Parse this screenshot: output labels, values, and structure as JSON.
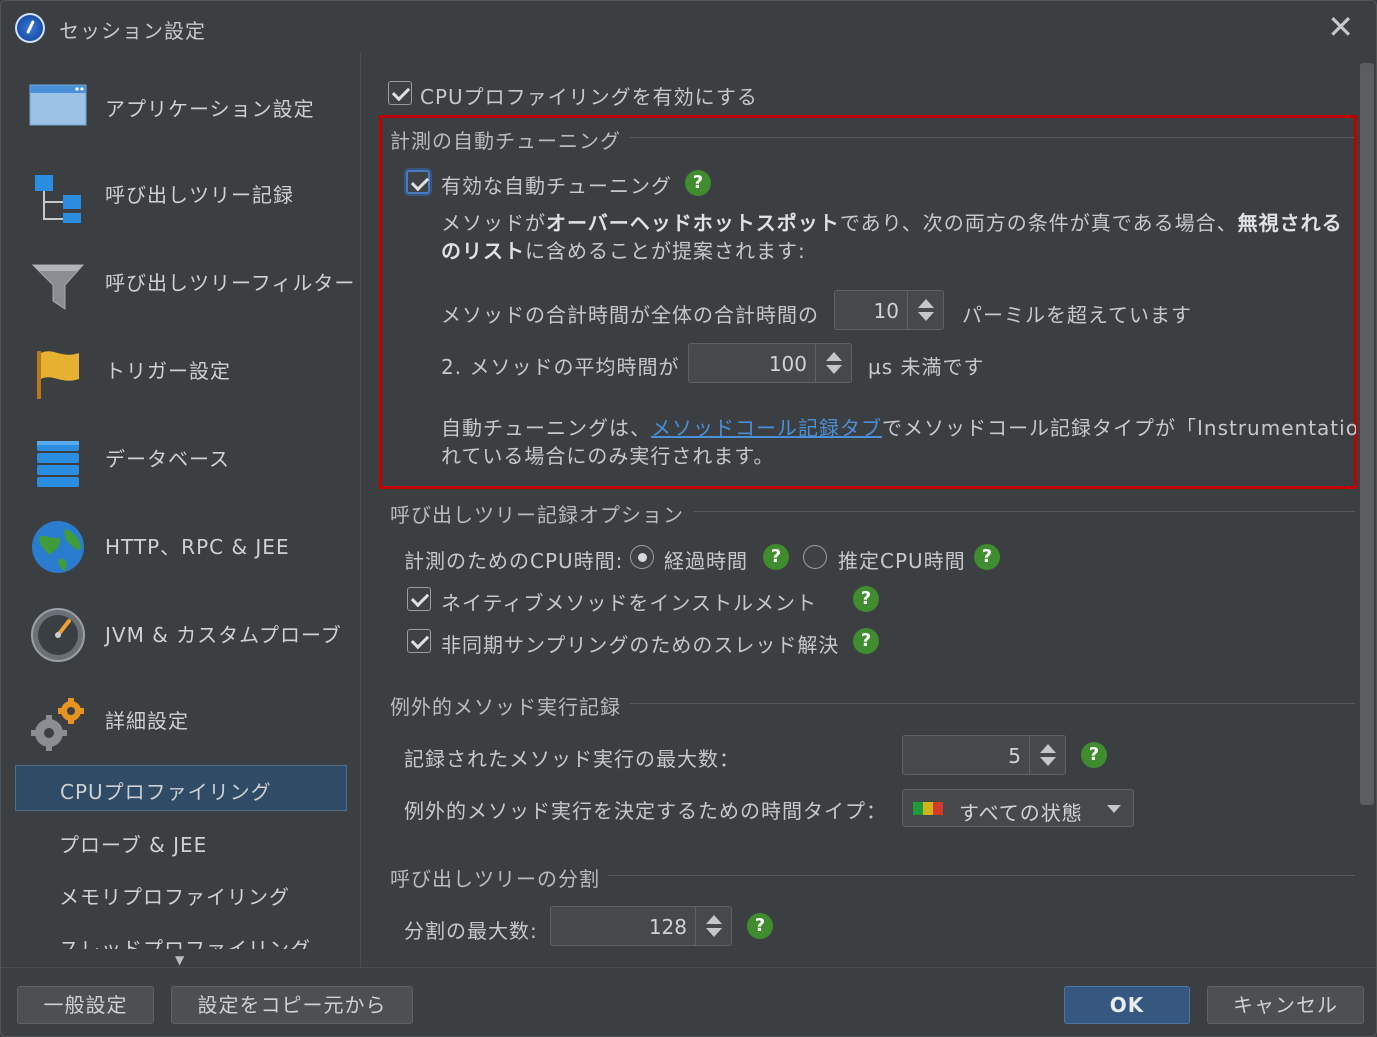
{
  "window": {
    "title": "セッション設定",
    "close_glyph": "✕"
  },
  "sidebar": {
    "items": [
      {
        "label": "アプリケーション設定",
        "icon": "application-window-icon"
      },
      {
        "label": "呼び出しツリー記録",
        "icon": "call-tree-icon"
      },
      {
        "label": "呼び出しツリーフィルター",
        "icon": "funnel-icon"
      },
      {
        "label": "トリガー設定",
        "icon": "flag-icon"
      },
      {
        "label": "データベース",
        "icon": "database-icon"
      },
      {
        "label": "HTTP、RPC & JEE",
        "icon": "globe-icon"
      },
      {
        "label": "JVM & カスタムプローブ",
        "icon": "gauge-icon"
      },
      {
        "label": "詳細設定",
        "icon": "gears-icon"
      }
    ],
    "subitems": [
      {
        "label": "CPUプロファイリング",
        "selected": true
      },
      {
        "label": "プローブ & JEE"
      },
      {
        "label": "メモリプロファイリング"
      },
      {
        "label": "スレッドプロファイリング"
      }
    ]
  },
  "main": {
    "enable_cpu": {
      "label": "CPUプロファイリングを有効にする",
      "checked": true
    },
    "autotune": {
      "section_title": "計測の自動チューニング",
      "enable_label": "有効な自動チューニング",
      "desc_a": "メソッドが",
      "desc_b": "オーバーヘッドホットスポット",
      "desc_c": "であり、次の両方の条件が真である場合、",
      "desc_d": "無視される",
      "desc_e": "のリスト",
      "desc_f": "に含めることが提案されます:",
      "cond1_label": "メソッドの合計時間が全体の合計時間の",
      "cond1_value": "10",
      "cond1_suffix": "パーミルを超えています",
      "cond2_label": "2. メソッドの平均時間が",
      "cond2_value": "100",
      "cond2_suffix": "µs 未満です",
      "note_a": "自動チューニングは、",
      "note_link": "メソッドコール記録タブ",
      "note_b": "でメソッドコール記録タイプが「Instrumentation」",
      "note_c": "れている場合にのみ実行されます。"
    },
    "calltree": {
      "section_title": "呼び出しツリー記録オプション",
      "cpu_time_label": "計測のためのCPU時間:",
      "radio_elapsed": "経過時間",
      "radio_estimated": "推定CPU時間",
      "native_label": "ネイティブメソッドをインストルメント",
      "async_label": "非同期サンプリングのためのスレッド解決"
    },
    "exceptional": {
      "section_title": "例外的メソッド実行記録",
      "max_label": "記録されたメソッド実行の最大数：",
      "max_value": "5",
      "timetype_label": "例外的メソッド実行を決定するための時間タイプ：",
      "timetype_value": "すべての状態",
      "swatch_colors": [
        "#1f9a3a",
        "#d4b21c",
        "#d23b2b"
      ]
    },
    "split": {
      "section_title": "呼び出しツリーの分割",
      "max_label": "分割の最大数:",
      "max_value": "128"
    },
    "help_glyph": "?"
  },
  "footer": {
    "general_label": "一般設定",
    "copy_label": "設定をコピー元から",
    "ok_label": "OK",
    "cancel_label": "キャンセル"
  }
}
